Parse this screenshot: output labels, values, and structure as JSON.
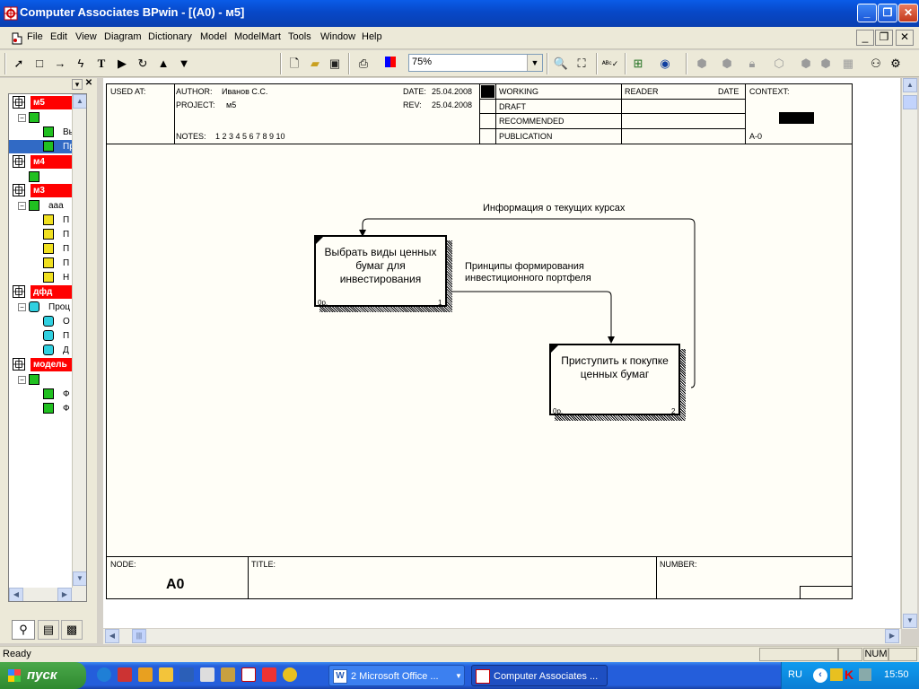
{
  "window": {
    "title": "Computer Associates BPwin - [(A0)  - м5]"
  },
  "menu": [
    "File",
    "Edit",
    "View",
    "Diagram",
    "Dictionary",
    "Model",
    "ModelMart",
    "Tools",
    "Window",
    "Help"
  ],
  "toolbar": {
    "zoom_value": "75%"
  },
  "tree": {
    "nodes": [
      {
        "label": "м5",
        "type": "model"
      },
      {
        "label": "",
        "type": "green"
      },
      {
        "label": "Вы",
        "type": "green"
      },
      {
        "label": "Пр",
        "type": "green",
        "selected": true
      },
      {
        "label": "м4",
        "type": "model"
      },
      {
        "label": "",
        "type": "green"
      },
      {
        "label": "м3",
        "type": "model"
      },
      {
        "label": "ааа",
        "type": "green"
      },
      {
        "label": "П",
        "type": "yellow"
      },
      {
        "label": "П",
        "type": "yellow"
      },
      {
        "label": "П",
        "type": "yellow"
      },
      {
        "label": "П",
        "type": "yellow"
      },
      {
        "label": "Н",
        "type": "yellow"
      },
      {
        "label": "дфд",
        "type": "model"
      },
      {
        "label": "Проц",
        "type": "cyan"
      },
      {
        "label": "О",
        "type": "cyan"
      },
      {
        "label": "П",
        "type": "cyan"
      },
      {
        "label": "Д",
        "type": "cyan"
      },
      {
        "label": "модель",
        "type": "model"
      },
      {
        "label": "",
        "type": "green"
      },
      {
        "label": "Ф",
        "type": "green"
      },
      {
        "label": "Ф",
        "type": "green"
      }
    ]
  },
  "frame": {
    "used_at": "USED AT:",
    "author_label": "AUTHOR:",
    "author": "Иванов С.С.",
    "project_label": "PROJECT:",
    "project": "м5",
    "date_label": "DATE:",
    "date": "25.04.2008",
    "rev_label": "REV:",
    "rev": "25.04.2008",
    "notes_label": "NOTES:",
    "notes": "1  2  3  4  5  6  7  8  9  10",
    "status": [
      "WORKING",
      "DRAFT",
      "RECOMMENDED",
      "PUBLICATION"
    ],
    "reader": "READER",
    "date_col": "DATE",
    "context": "CONTEXT:",
    "context_node": "A-0",
    "node_label": "NODE:",
    "node": "A0",
    "title_label": "TITLE:",
    "number_label": "NUMBER:"
  },
  "diagram": {
    "boxes": [
      {
        "text": "Выбрать виды ценных бумаг для инвестирования",
        "cost": "0р.",
        "num": "1"
      },
      {
        "text": "Приступить к покупке ценных бумаг",
        "cost": "0р.",
        "num": "2"
      }
    ],
    "arrows": [
      {
        "label": "Информация о текущих курсах"
      },
      {
        "label": "Принципы формирования инвестиционного портфеля"
      }
    ]
  },
  "status": {
    "text": "Ready",
    "num": "NUM"
  },
  "taskbar": {
    "start": "пуск",
    "tasks": [
      "2 Microsoft Office ...",
      "Computer Associates ..."
    ],
    "lang": "RU",
    "clock": "15:50"
  },
  "colors": {
    "titlebar": "#0a5ce8",
    "model_node": "#ff0000",
    "taskbar": "#245edb"
  }
}
